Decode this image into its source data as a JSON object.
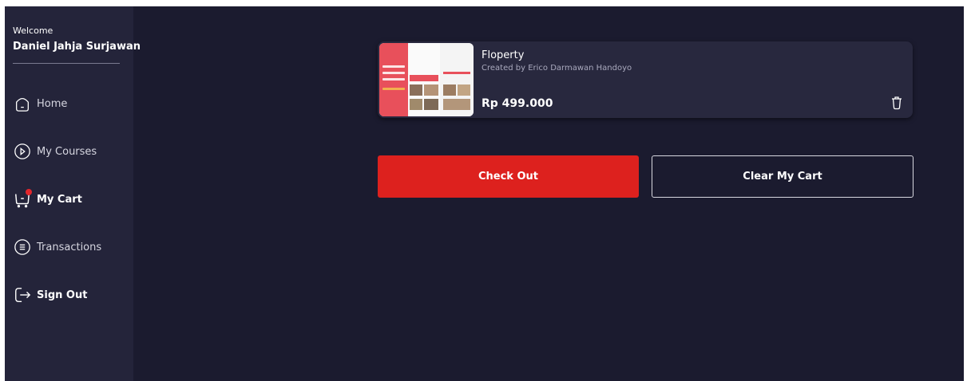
{
  "sidebar": {
    "welcome": "Welcome",
    "username": "Daniel Jahja Surjawan",
    "items": [
      {
        "label": "Home",
        "icon": "home-icon"
      },
      {
        "label": "My Courses",
        "icon": "play-circle-icon"
      },
      {
        "label": "My Cart",
        "icon": "cart-icon",
        "active": true
      },
      {
        "label": "Transactions",
        "icon": "receipt-icon"
      },
      {
        "label": "Sign Out",
        "icon": "sign-out-icon"
      }
    ]
  },
  "cart": {
    "items": [
      {
        "title": "Floperty",
        "author": "Created by Erico Darmawan Handoyo",
        "price": "Rp 499.000"
      }
    ]
  },
  "actions": {
    "checkout_label": "Check Out",
    "clear_label": "Clear My Cart"
  },
  "colors": {
    "background": "#1b1b2f",
    "sidebar": "#24243a",
    "accent": "#dd211e",
    "card": "#28283e"
  }
}
